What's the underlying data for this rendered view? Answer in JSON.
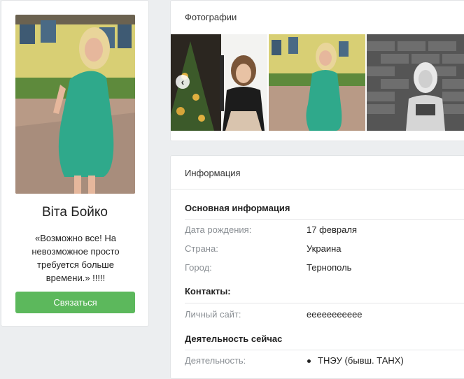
{
  "profile": {
    "name": "Віта Бойко",
    "status": "«Возможно все! На невозможное просто требуется больше времени.» !!!!!",
    "contact_button": "Связаться"
  },
  "photos": {
    "title": "Фотографии",
    "prev_icon": "chevron-left-icon"
  },
  "info": {
    "title": "Информация",
    "sections": {
      "basic": {
        "title": "Основная информация",
        "birthday_label": "Дата рождения:",
        "birthday_value": "17 февраля",
        "country_label": "Страна:",
        "country_value": "Украина",
        "city_label": "Город:",
        "city_value": "Тернополь"
      },
      "contacts": {
        "title": "Контакты:",
        "site_label": "Личный сайт:",
        "site_value": "eeeeeeeeeee"
      },
      "activity": {
        "title": "Деятельность сейчас",
        "activity_label": "Деятельность:",
        "activity_value": "ТНЭУ (бывш. ТАНХ)"
      }
    }
  },
  "colors": {
    "accent": "#5cb85c",
    "background": "#eceef0",
    "label": "#8a8f94"
  }
}
